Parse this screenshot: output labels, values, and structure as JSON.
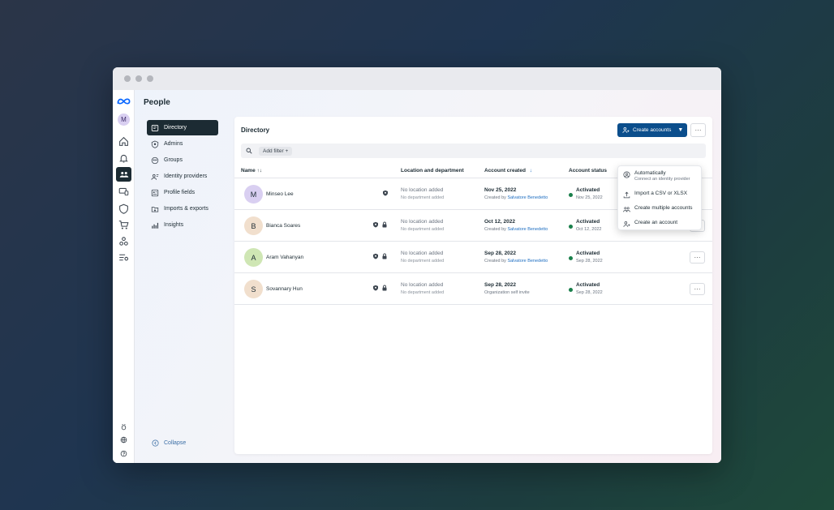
{
  "page": {
    "title": "People"
  },
  "user": {
    "avatar_initial": "M"
  },
  "nav": {
    "items": [
      {
        "label": "Directory",
        "icon": "directory-icon",
        "active": true
      },
      {
        "label": "Admins",
        "icon": "shield-icon"
      },
      {
        "label": "Groups",
        "icon": "groups-icon"
      },
      {
        "label": "Identity providers",
        "icon": "identity-icon"
      },
      {
        "label": "Profile fields",
        "icon": "profile-fields-icon"
      },
      {
        "label": "Imports & exports",
        "icon": "imports-icon"
      },
      {
        "label": "Insights",
        "icon": "insights-icon"
      }
    ],
    "collapse_label": "Collapse"
  },
  "directory": {
    "title": "Directory",
    "create_button": "Create accounts",
    "more": "···",
    "add_filter": "Add filter",
    "columns": {
      "name": "Name ↑↓",
      "location": "Location and department",
      "created": "Account created",
      "status": "Account status"
    },
    "rows": [
      {
        "initial": "M",
        "name": "Minseo Lee",
        "avatar_color": "#d9cff1",
        "lock": false,
        "location": "No location added",
        "department": "No department added",
        "created": "Nov 25, 2022",
        "created_by_prefix": "Created by ",
        "created_by": "Salvatore Benedetto",
        "status": "Activated",
        "status_date": "Nov 25, 2022"
      },
      {
        "initial": "B",
        "name": "Bianca Soares",
        "avatar_color": "#f1dfcd",
        "lock": true,
        "location": "No location added",
        "department": "No department added",
        "created": "Oct 12, 2022",
        "created_by_prefix": "Created by ",
        "created_by": "Salvatore Benedetto",
        "status": "Activated",
        "status_date": "Oct 12, 2022"
      },
      {
        "initial": "A",
        "name": "Aram Vahanyan",
        "avatar_color": "#cfe6b4",
        "lock": true,
        "location": "No location added",
        "department": "No department added",
        "created": "Sep 28, 2022",
        "created_by_prefix": "Created by ",
        "created_by": "Salvatore Benedetto",
        "status": "Activated",
        "status_date": "Sep 28, 2022"
      },
      {
        "initial": "S",
        "name": "Sovannary Hun",
        "avatar_color": "#f1dfcd",
        "lock": true,
        "location": "No location added",
        "department": "No department added",
        "created": "Sep 28, 2022",
        "created_by_prefix": "Organization self invite",
        "created_by": "",
        "status": "Activated",
        "status_date": "Sep 28, 2022"
      }
    ]
  },
  "dropdown": {
    "items": [
      {
        "label": "Automatically",
        "sub": "Connect an identity provider"
      },
      {
        "label": "Import a CSV or XLSX"
      },
      {
        "label": "Create multiple accounts"
      },
      {
        "label": "Create an account"
      }
    ]
  },
  "colors": {
    "accent": "#0b4e8c",
    "nav_active": "#1c2b33",
    "status_active": "#1a7f4b",
    "link": "#1f6fc2"
  }
}
